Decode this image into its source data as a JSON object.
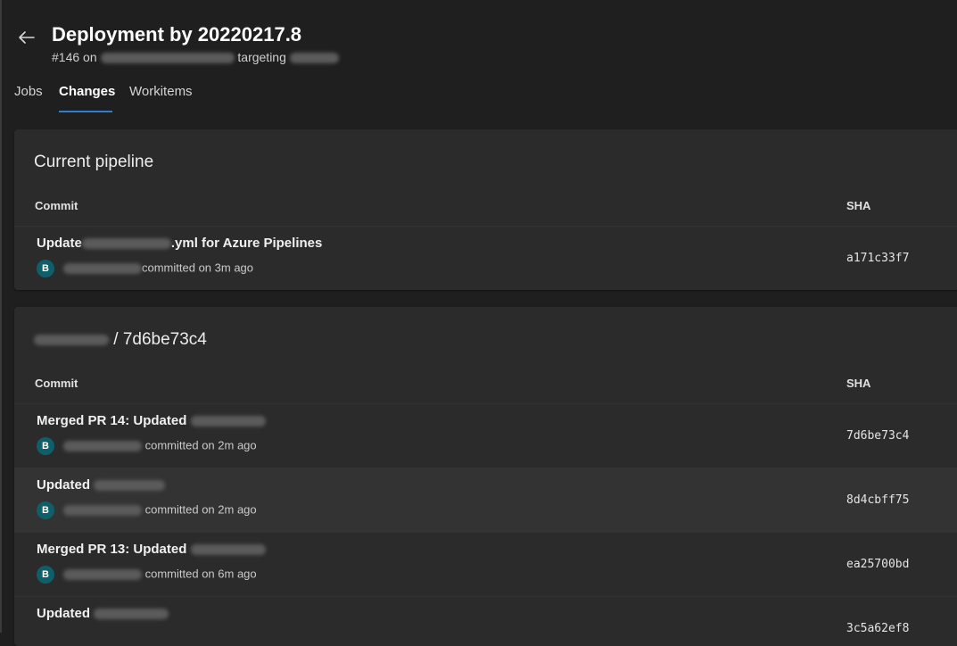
{
  "header": {
    "title": "Deployment by 20220217.8",
    "subtitle_prefix": "#146 on",
    "subtitle_mid": "targeting"
  },
  "tabs": [
    {
      "label": "Jobs",
      "active": false
    },
    {
      "label": "Changes",
      "active": true
    },
    {
      "label": "Workitems",
      "active": false
    }
  ],
  "current_pipeline": {
    "title": "Current pipeline",
    "col_commit": "Commit",
    "col_sha": "SHA",
    "commits": [
      {
        "title_prefix": "Update",
        "title_suffix": ".yml for Azure Pipelines",
        "avatar": "B",
        "meta": "committed on 3m ago",
        "sha": "a171c33f7"
      }
    ]
  },
  "repo_section": {
    "title_suffix": "/ 7d6be73c4",
    "col_commit": "Commit",
    "col_sha": "SHA",
    "commits": [
      {
        "title_prefix": "Merged PR 14: Updated",
        "avatar": "B",
        "meta": "committed on 2m ago",
        "sha": "7d6be73c4"
      },
      {
        "title_prefix": "Updated",
        "avatar": "B",
        "meta": "committed on 2m ago",
        "sha": "8d4cbff75"
      },
      {
        "title_prefix": "Merged PR 13: Updated",
        "avatar": "B",
        "meta": "committed on 6m ago",
        "sha": "ea25700bd"
      },
      {
        "title_prefix": "Updated",
        "avatar": "B",
        "meta": "",
        "sha": "3c5a62ef8"
      }
    ]
  },
  "colors": {
    "accent": "#2f7fd1",
    "avatar_bg": "#0f5f6b",
    "background": "#1f1f1f",
    "card": "#2b2b2b"
  },
  "icons": {
    "back": "arrow-left-icon"
  }
}
